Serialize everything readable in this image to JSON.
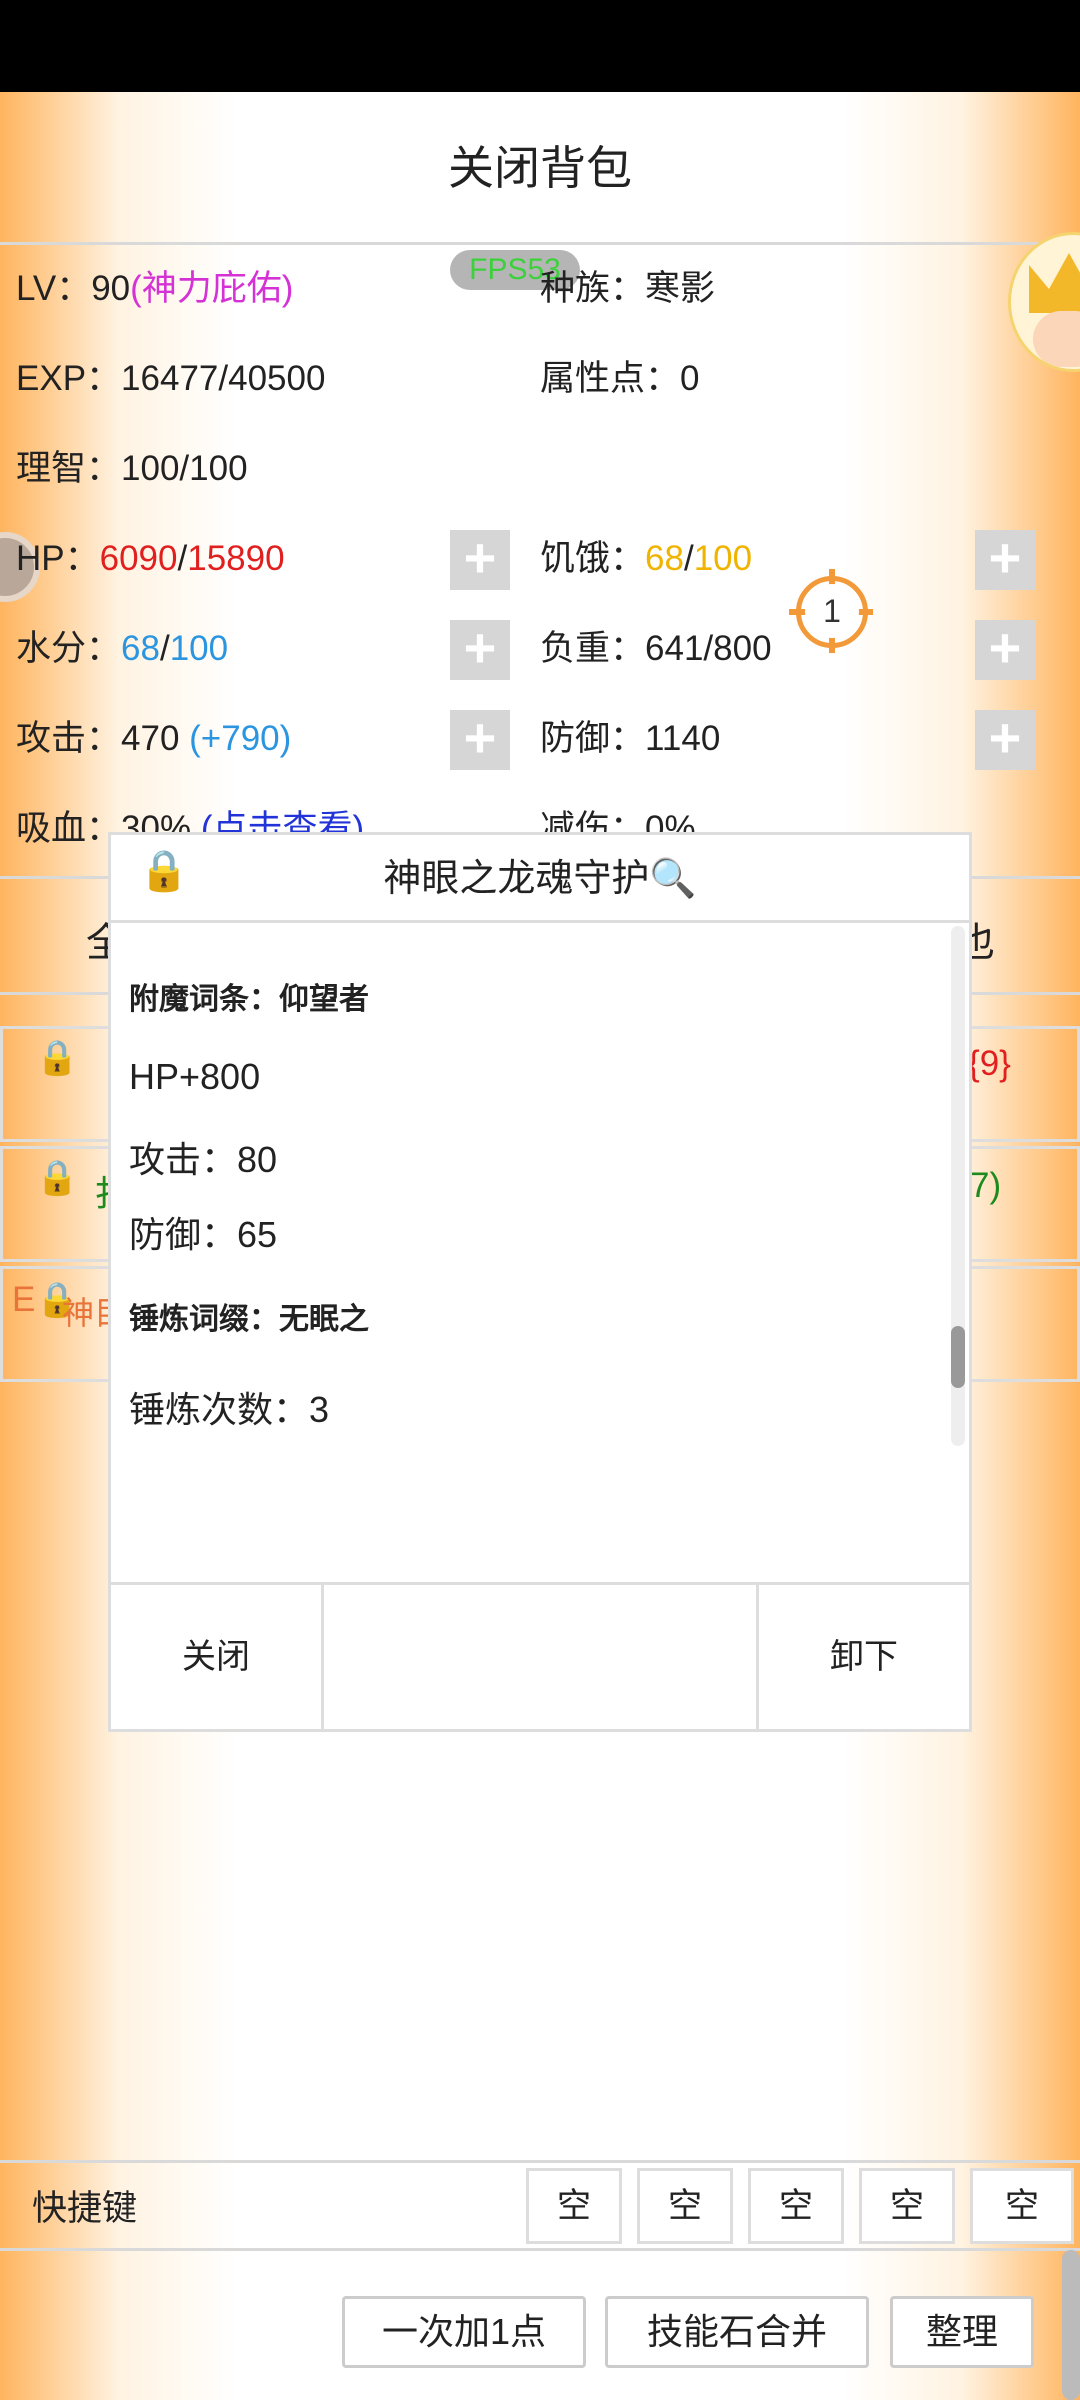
{
  "header": {
    "title": "关闭背包"
  },
  "fps": "FPS53",
  "stats": {
    "lv_label": "LV：",
    "lv_value": "90",
    "lv_note": "(神力庇佑)",
    "race_label": "种族：",
    "race_value": "寒影",
    "exp_label": "EXP：",
    "exp_value": "16477/40500",
    "attr_label": "属性点：",
    "attr_value": "0",
    "sanity_label": "理智：",
    "sanity_value": "100/100",
    "hp_label": "HP：",
    "hp_cur": "6090",
    "hp_sep": "/",
    "hp_max": "15890",
    "hunger_label": "饥饿：",
    "hunger_cur": "68",
    "hunger_sep": "/",
    "hunger_max": "100",
    "water_label": "水分：",
    "water_cur": "68",
    "water_sep": "/",
    "water_max": "100",
    "load_label": "负重：",
    "load_value": "641/800",
    "atk_label": "攻击：",
    "atk_value": "470",
    "atk_bonus": "(+790)",
    "def_label": "防御：",
    "def_value": "1140",
    "leech_label": "吸血：",
    "leech_value": "30%",
    "leech_link": "(点击查看)",
    "dmgred_label": "减伤：",
    "dmgred_value": "0%"
  },
  "plus_symbol": "+",
  "marker_number": "1",
  "behind": {
    "tab_left": "全",
    "tab_right": "也",
    "row1_right": "{9}",
    "row2_left": "扌",
    "row2_right": "7)",
    "row3_prefix": "E",
    "row3_text": "神目"
  },
  "modal": {
    "lock": "🔒",
    "title": "神眼之龙魂守护🔍",
    "enchant_heading": "附魔词条：仰望者",
    "lines": [
      "HP+800",
      "攻击：80",
      "防御：65"
    ],
    "forge_heading": "锤炼词缀：无眠之",
    "forge_count": "锤炼次数：3",
    "close_button": "关闭",
    "unequip_button": "卸下"
  },
  "hotkeys": {
    "label": "快捷键",
    "slots": [
      "空",
      "空",
      "空",
      "空",
      "空"
    ]
  },
  "bottom_buttons": {
    "add_one": "一次加1点",
    "merge": "技能石合并",
    "sort": "整理"
  }
}
